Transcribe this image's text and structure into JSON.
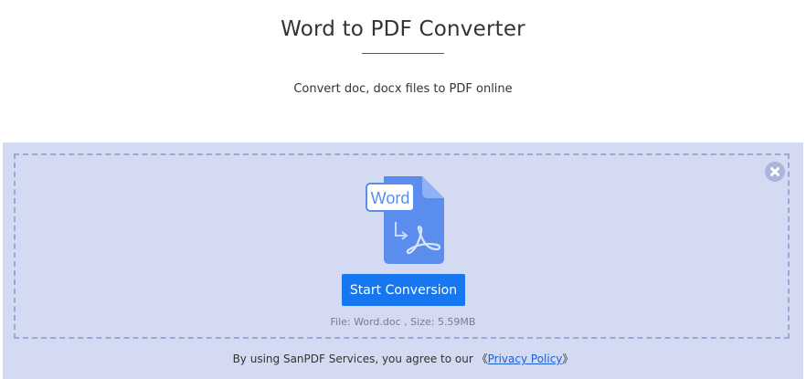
{
  "header": {
    "title": "Word to PDF Converter",
    "subtitle": "Convert doc, docx files to PDF online"
  },
  "upload": {
    "file_badge": "Word",
    "start_label": "Start Conversion",
    "file_name_text": "File: Word.doc",
    "file_separator": " , ",
    "file_size_text": "Size: 5.59MB"
  },
  "footer": {
    "consent_text": "By using SanPDF Services, you agree to our ",
    "bracket_open": "《",
    "privacy_link": "Privacy Policy",
    "bracket_close": "》"
  },
  "colors": {
    "panel_bg": "#d3daf1",
    "dash_border": "#9aa8d6",
    "button_blue": "#1677f0",
    "file_icon_blue": "#5b8def",
    "link_blue": "#1a5fd8"
  },
  "icons": {
    "close": "close-icon",
    "file": "word-to-pdf-file-icon",
    "arrow": "arrow-down-right-icon",
    "pdf": "acrobat-pdf-icon"
  }
}
